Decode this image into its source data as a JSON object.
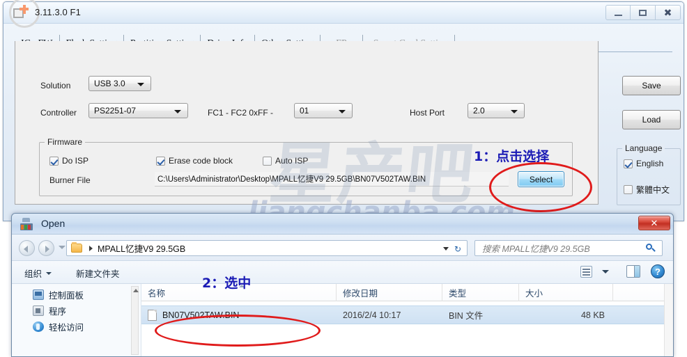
{
  "main_window": {
    "title": "3.11.3.0 F1",
    "app_icon": "mpall-app-icon",
    "window_controls": {
      "minimize": "–",
      "maximize": "□",
      "close": "✕"
    },
    "tabs": [
      {
        "label": "IC _FW",
        "enabled": true,
        "active": true
      },
      {
        "label": "Flash Setting",
        "enabled": true,
        "active": false
      },
      {
        "label": "Partition Setting",
        "enabled": true,
        "active": false
      },
      {
        "label": "Drive Info",
        "enabled": true,
        "active": false
      },
      {
        "label": "Other Setting",
        "enabled": true,
        "active": false
      },
      {
        "label": "FP",
        "enabled": false,
        "active": false
      },
      {
        "label": "Smart Card Setting",
        "enabled": false,
        "active": false
      }
    ],
    "fields": {
      "solution_label": "Solution",
      "solution_value": "USB 3.0",
      "controller_label": "Controller",
      "controller_value": "PS2251-07",
      "fc_label": "FC1 - FC2   0xFF -",
      "fc_value": "01",
      "host_port_label": "Host Port",
      "host_port_value": "2.0"
    },
    "firmware": {
      "group_title": "Firmware",
      "do_isp_label": "Do ISP",
      "do_isp_checked": true,
      "erase_code_block_label": "Erase code block",
      "erase_code_block_checked": true,
      "auto_isp_label": "Auto ISP",
      "auto_isp_checked": false,
      "burner_file_label": "Burner File",
      "burner_file_value": "C:\\Users\\Administrator\\Desktop\\MPALL忆捷V9 29.5GB\\BN07V502TAW.BIN",
      "select_button": "Select"
    },
    "side_buttons": {
      "save": "Save",
      "load": "Load"
    },
    "language": {
      "group_title": "Language",
      "english_label": "English",
      "english_checked": true,
      "traditional_chinese_label": "繁體中文",
      "traditional_chinese_checked": false
    }
  },
  "watermarks": {
    "chinese": "星产吧",
    "english": "liangchanba.com"
  },
  "annotations": [
    {
      "text": "1：点击选择",
      "color": "#1b1bb5"
    },
    {
      "text": "2：选中",
      "color": "#1b1bb5"
    }
  ],
  "highlight_color": "#e01b1b",
  "open_dialog": {
    "title": "Open",
    "icon": "folder-open-icon",
    "close_label": "✕",
    "navigation": {
      "back_icon": "back-arrow-icon",
      "forward_icon": "forward-arrow-icon",
      "breadcrumb_folder_icon": "folder-icon",
      "breadcrumb_text": "MPALL忆捷V9 29.5GB",
      "refresh_icon": "refresh-icon",
      "search_placeholder": "搜索 MPALL忆捷V9 29.5GB",
      "search_value": "",
      "search_icon": "magnifier-icon"
    },
    "command_bar": {
      "organize_label": "组织",
      "new_folder_label": "新建文件夹",
      "view_icon": "view-mode-icon",
      "preview_pane_icon": "preview-pane-icon",
      "help_label": "?"
    },
    "sidebar": [
      {
        "label": "控制面板",
        "icon": "control-panel-icon"
      },
      {
        "label": "程序",
        "icon": "programs-icon"
      },
      {
        "label": "轻松访问",
        "icon": "ease-of-access-icon"
      }
    ],
    "columns": [
      "名称",
      "修改日期",
      "类型",
      "大小"
    ],
    "rows": [
      {
        "icon": "bin-file-icon",
        "name": "BN07V502TAW.BIN",
        "date_modified": "2016/2/4 10:17",
        "type": "BIN 文件",
        "size": "48 KB",
        "selected": true
      }
    ]
  }
}
